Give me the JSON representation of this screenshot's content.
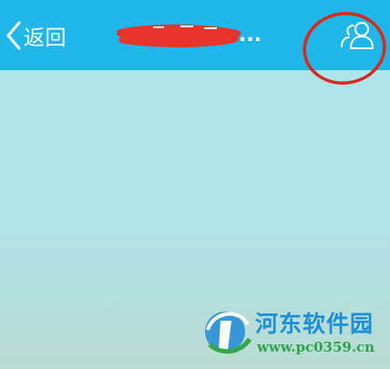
{
  "header": {
    "back_label": "返回",
    "title_visible_suffix": "...",
    "title_redacted": true
  },
  "icons": {
    "back": "chevron-left-icon",
    "contact": "group-people-icon",
    "annotation": "red-circle-annotation"
  },
  "watermark": {
    "brand": "河东软件园",
    "url": "www.pc0359.cn"
  },
  "colors": {
    "topbar": "#1fb6ea",
    "background_top": "#ade6ef",
    "background_bottom": "#b9dcd3",
    "annotation": "#d9291b",
    "watermark_brand": "#1d8fd6",
    "watermark_url": "#30a24a"
  }
}
